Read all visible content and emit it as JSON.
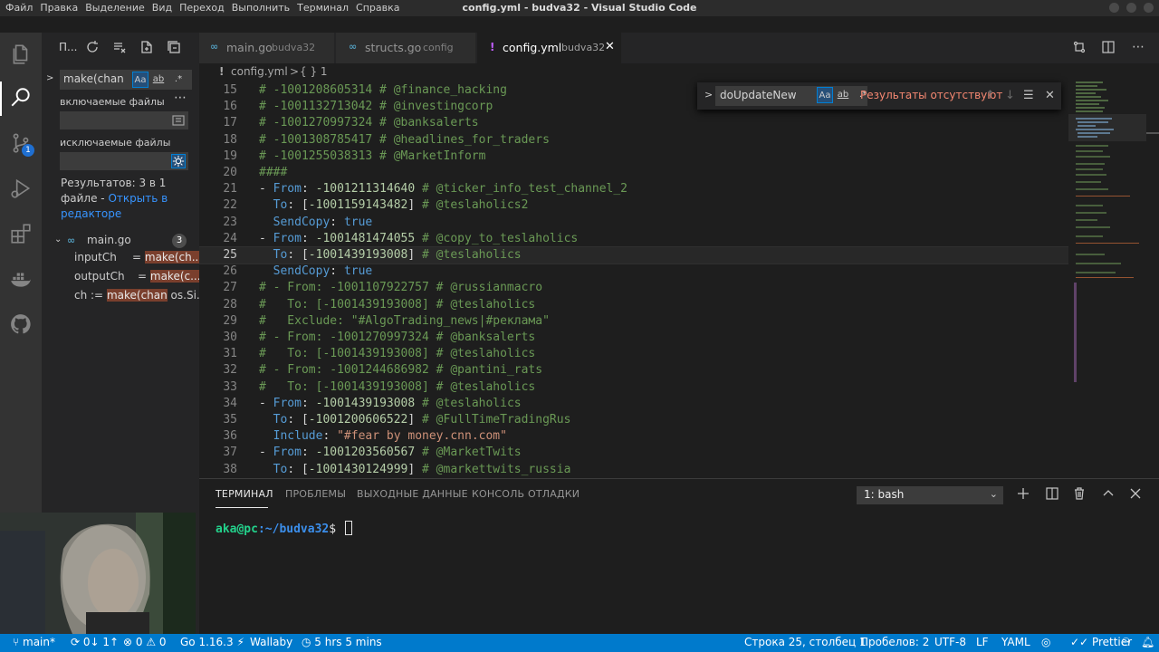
{
  "window": {
    "title": "config.yml - budva32 - Visual Studio Code",
    "menu": [
      "Файл",
      "Правка",
      "Выделение",
      "Вид",
      "Переход",
      "Выполнить",
      "Терминал",
      "Справка"
    ]
  },
  "sidebar": {
    "title": "П...",
    "search_value": "make(chan",
    "match_case_label": "Aa",
    "whole_word_label": "ab",
    "regex_label": ".*",
    "include_label": "включаемые файлы",
    "exclude_label": "исключаемые файлы",
    "results_summary": "Результатов: 3 в 1 файле - ",
    "open_in_editor": "Открыть в редакторе",
    "file": {
      "name": "main.go",
      "count": "3"
    },
    "matches": [
      {
        "prefix": "inputCh",
        "gap": "= ",
        "hl": "make(ch...",
        "rest": ""
      },
      {
        "prefix": "outputCh",
        "gap": "= ",
        "hl": "make(c...",
        "rest": ""
      },
      {
        "prefix": "ch := ",
        "gap": "",
        "hl": "make(chan",
        "rest": " os.Si..."
      }
    ],
    "scm_badge": "1"
  },
  "tabs": [
    {
      "name": "main.go",
      "desc": "budva32",
      "icon": "go"
    },
    {
      "name": "structs.go",
      "desc": "config",
      "icon": "go"
    },
    {
      "name": "config.yml",
      "desc": "budva32",
      "icon": "!"
    }
  ],
  "breadcrumb": {
    "file": "config.yml",
    "sep": ">",
    "symbol": "{ } 1"
  },
  "find_widget": {
    "value": "doUpdateNewM",
    "case_label": "Aa",
    "word_label": "ab",
    "regex_label": ".*",
    "no_results": "Результаты отсутствуют"
  },
  "code": [
    {
      "n": "15",
      "t": [
        [
          "cm",
          "# -1001208605314 # @finance_hacking"
        ]
      ]
    },
    {
      "n": "16",
      "t": [
        [
          "cm",
          "# -1001132713042 # @investingcorp"
        ]
      ]
    },
    {
      "n": "17",
      "t": [
        [
          "cm",
          "# -1001270997324 # @banksalerts"
        ]
      ]
    },
    {
      "n": "18",
      "t": [
        [
          "cm",
          "# -1001308785417 # @headlines_for_traders"
        ]
      ]
    },
    {
      "n": "19",
      "t": [
        [
          "cm",
          "# -1001255038313 # @MarketInform"
        ]
      ]
    },
    {
      "n": "20",
      "t": [
        [
          "cm",
          "####"
        ]
      ]
    },
    {
      "n": "21",
      "t": [
        [
          "plain",
          "- "
        ],
        [
          "key",
          "From"
        ],
        [
          "plain",
          ": "
        ],
        [
          "num",
          "-1001211314640"
        ],
        [
          "cm",
          " # @ticker_info_test_channel_2"
        ]
      ]
    },
    {
      "n": "22",
      "t": [
        [
          "plain",
          "  "
        ],
        [
          "key",
          "To"
        ],
        [
          "plain",
          ": ["
        ],
        [
          "num",
          "-1001159143482"
        ],
        [
          "plain",
          "]"
        ],
        [
          "cm",
          " # @teslaholics2"
        ]
      ]
    },
    {
      "n": "23",
      "t": [
        [
          "plain",
          "  "
        ],
        [
          "key",
          "SendCopy"
        ],
        [
          "plain",
          ": "
        ],
        [
          "key",
          "true"
        ]
      ]
    },
    {
      "n": "24",
      "t": [
        [
          "plain",
          "- "
        ],
        [
          "key",
          "From"
        ],
        [
          "plain",
          ": "
        ],
        [
          "num",
          "-1001481474055"
        ],
        [
          "cm",
          " # @copy_to_teslaholics"
        ]
      ]
    },
    {
      "n": "25",
      "t": [
        [
          "plain",
          "  "
        ],
        [
          "key",
          "To"
        ],
        [
          "plain",
          ": ["
        ],
        [
          "num",
          "-1001439193008"
        ],
        [
          "plain",
          "]"
        ],
        [
          "cm",
          " # @teslaholics"
        ]
      ],
      "current": true
    },
    {
      "n": "26",
      "t": [
        [
          "plain",
          "  "
        ],
        [
          "key",
          "SendCopy"
        ],
        [
          "plain",
          ": "
        ],
        [
          "key",
          "true"
        ]
      ]
    },
    {
      "n": "27",
      "t": [
        [
          "cm",
          "# - From: -1001107922757 # @russianmacro"
        ]
      ]
    },
    {
      "n": "28",
      "t": [
        [
          "cm",
          "#   To: [-1001439193008] # @teslaholics"
        ]
      ]
    },
    {
      "n": "29",
      "t": [
        [
          "cm",
          "#   Exclude: \"#AlgoTrading_news|#реклама\""
        ]
      ]
    },
    {
      "n": "30",
      "t": [
        [
          "cm",
          "# - From: -1001270997324 # @banksalerts"
        ]
      ]
    },
    {
      "n": "31",
      "t": [
        [
          "cm",
          "#   To: [-1001439193008] # @teslaholics"
        ]
      ]
    },
    {
      "n": "32",
      "t": [
        [
          "cm",
          "# - From: -1001244686982 # @pantini_rats"
        ]
      ]
    },
    {
      "n": "33",
      "t": [
        [
          "cm",
          "#   To: [-1001439193008] # @teslaholics"
        ]
      ]
    },
    {
      "n": "34",
      "t": [
        [
          "plain",
          "- "
        ],
        [
          "key",
          "From"
        ],
        [
          "plain",
          ": "
        ],
        [
          "num",
          "-1001439193008"
        ],
        [
          "cm",
          " # @teslaholics"
        ]
      ]
    },
    {
      "n": "35",
      "t": [
        [
          "plain",
          "  "
        ],
        [
          "key",
          "To"
        ],
        [
          "plain",
          ": ["
        ],
        [
          "num",
          "-1001200606522"
        ],
        [
          "plain",
          "]"
        ],
        [
          "cm",
          " # @FullTimeTradingRus"
        ]
      ]
    },
    {
      "n": "36",
      "t": [
        [
          "plain",
          "  "
        ],
        [
          "key",
          "Include"
        ],
        [
          "plain",
          ": "
        ],
        [
          "str",
          "\"#fear by money.cnn.com\""
        ]
      ]
    },
    {
      "n": "37",
      "t": [
        [
          "plain",
          "- "
        ],
        [
          "key",
          "From"
        ],
        [
          "plain",
          ": "
        ],
        [
          "num",
          "-1001203560567"
        ],
        [
          "cm",
          " # @MarketTwits"
        ]
      ]
    },
    {
      "n": "38",
      "t": [
        [
          "plain",
          "  "
        ],
        [
          "key",
          "To"
        ],
        [
          "plain",
          ": ["
        ],
        [
          "num",
          "-1001430124999"
        ],
        [
          "plain",
          "]"
        ],
        [
          "cm",
          " # @markettwits_russia"
        ]
      ]
    }
  ],
  "panel": {
    "tabs": [
      "ТЕРМИНАЛ",
      "ПРОБЛЕМЫ",
      "ВЫХОДНЫЕ ДАННЫЕ",
      "КОНСОЛЬ ОТЛАДКИ"
    ],
    "terminal_select": "1: bash",
    "prompt_user": "aka@pc",
    "prompt_path": ":~/budva32",
    "prompt_dollar": "$ "
  },
  "statusbar": {
    "branch": "main*",
    "sync": "0↓ 1↑",
    "errors": "0",
    "warnings": "0",
    "go_version": "Go 1.16.3",
    "wallaby": "Wallaby",
    "time": "5 hrs 5 mins",
    "position": "Строка 25, столбец 1",
    "spaces": "Пробелов: 2",
    "encoding": "UTF-8",
    "eol": "LF",
    "language": "YAML",
    "prettier": "Prettier"
  },
  "colors": {
    "accent": "#007acc",
    "comment": "#6a9955",
    "keyword": "#569cd6",
    "number": "#b5cea8",
    "string": "#ce9178",
    "no_results": "#f48771"
  }
}
